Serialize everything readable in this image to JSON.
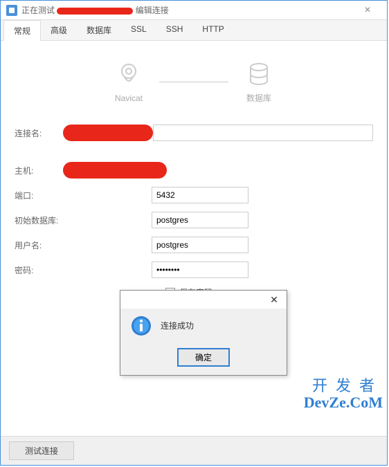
{
  "titlebar": {
    "prefix": "正在测试",
    "suffix": "编辑连接"
  },
  "tabs": [
    "常规",
    "高级",
    "数据库",
    "SSL",
    "SSH",
    "HTTP"
  ],
  "diagram": {
    "left": "Navicat",
    "right": "数据库"
  },
  "form": {
    "conn_name_label": "连接名:",
    "conn_name_value": "",
    "host_label": "主机:",
    "host_value": "",
    "port_label": "端口:",
    "port_value": "5432",
    "initdb_label": "初始数据库:",
    "initdb_value": "postgres",
    "user_label": "用户名:",
    "user_value": "postgres",
    "pass_label": "密码:",
    "pass_value": "••••••••",
    "save_pass_label": "保存密码"
  },
  "modal": {
    "message": "连接成功",
    "ok": "确定"
  },
  "footer": {
    "test_btn": "测试连接"
  },
  "watermark": {
    "line1": "开发者",
    "line2": "DevZe.CoM"
  }
}
